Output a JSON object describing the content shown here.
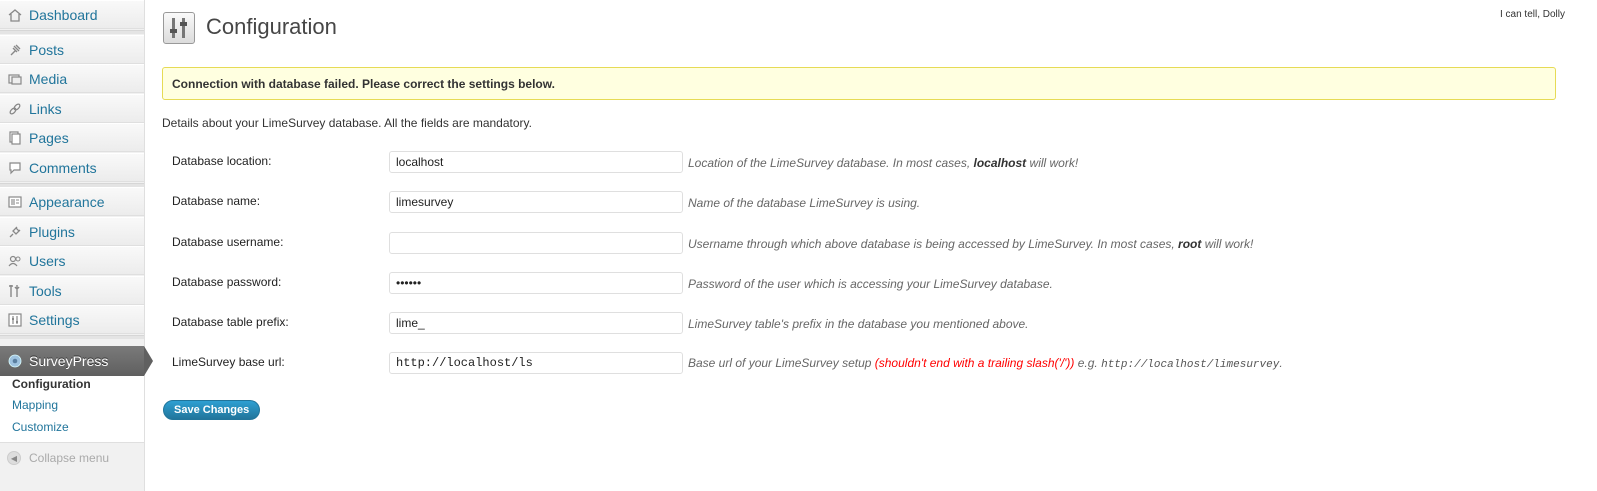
{
  "sidebar": {
    "items": [
      {
        "label": "Dashboard",
        "icon": "dashboard-icon"
      },
      {
        "label": "Posts",
        "icon": "pin-icon"
      },
      {
        "label": "Media",
        "icon": "media-icon"
      },
      {
        "label": "Links",
        "icon": "link-icon"
      },
      {
        "label": "Pages",
        "icon": "pages-icon"
      },
      {
        "label": "Comments",
        "icon": "comment-icon"
      },
      {
        "label": "Appearance",
        "icon": "appearance-icon"
      },
      {
        "label": "Plugins",
        "icon": "plugin-icon"
      },
      {
        "label": "Users",
        "icon": "users-icon"
      },
      {
        "label": "Tools",
        "icon": "tools-icon"
      },
      {
        "label": "Settings",
        "icon": "settings-icon"
      }
    ],
    "current": {
      "label": "SurveyPress",
      "icon": "gear-icon"
    },
    "submenu": [
      "Configuration",
      "Mapping",
      "Customize"
    ],
    "collapse_label": "Collapse menu"
  },
  "header": {
    "dolly": "I can tell, Dolly",
    "title": "Configuration"
  },
  "notice": "Connection with database failed. Please correct the settings below.",
  "intro": "Details about your LimeSurvey database. All the fields are mandatory.",
  "form": {
    "rows": [
      {
        "label": "Database location:",
        "value": "localhost",
        "desc_pre": "Location of the LimeSurvey database. In most cases, ",
        "desc_bold": "localhost",
        "desc_post": " will work!"
      },
      {
        "label": "Database name:",
        "value": "limesurvey",
        "desc": "Name of the database LimeSurvey is using."
      },
      {
        "label": "Database username:",
        "value": "",
        "desc_pre": "Username through which above database is being accessed by LimeSurvey. In most cases, ",
        "desc_bold": "root",
        "desc_post": " will work!"
      },
      {
        "label": "Database password:",
        "value": "••••••",
        "desc": "Password of the user which is accessing your LimeSurvey database."
      },
      {
        "label": "Database table prefix:",
        "value": "lime_",
        "desc": "LimeSurvey table's prefix in the database you mentioned above."
      },
      {
        "label": "LimeSurvey base url:",
        "value": "http://localhost/ls",
        "desc_pre": "Base url of your LimeSurvey setup ",
        "desc_warn": "(shouldn't end with a trailing slash('/'))",
        "desc_mid": " e.g. ",
        "desc_code": "http://localhost/limesurvey",
        "desc_post": "."
      }
    ],
    "save_label": "Save Changes"
  },
  "colors": {
    "link": "#21759b",
    "notice_bg": "#ffffe0",
    "notice_border": "#e6db55",
    "warn": "#ff0000"
  }
}
